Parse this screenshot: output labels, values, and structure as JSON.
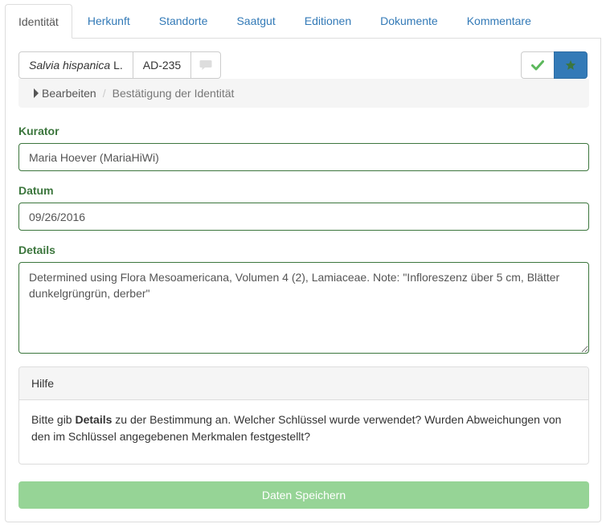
{
  "tabs": [
    {
      "label": "Identität",
      "active": true
    },
    {
      "label": "Herkunft",
      "active": false
    },
    {
      "label": "Standorte",
      "active": false
    },
    {
      "label": "Saatgut",
      "active": false
    },
    {
      "label": "Editionen",
      "active": false
    },
    {
      "label": "Dokumente",
      "active": false
    },
    {
      "label": "Kommentare",
      "active": false
    }
  ],
  "identity": {
    "species": "Salvia hispanica",
    "author": "L.",
    "accession": "AD-235"
  },
  "breadcrumb": {
    "edit": "Bearbeiten",
    "current": "Bestätigung der Identität"
  },
  "form": {
    "curator_label": "Kurator",
    "curator_value": "Maria Hoever (MariaHiWi)",
    "date_label": "Datum",
    "date_value": "09/26/2016",
    "details_label": "Details",
    "details_value": "Determined using Flora Mesoamericana, Volumen 4 (2), Lamiaceae. Note: \"Infloreszenz über 5 cm, Blätter dunkelgrüngrün, derber\""
  },
  "help": {
    "title": "Hilfe",
    "text_before": "Bitte gib ",
    "text_bold": "Details",
    "text_after": " zu der Bestimmung an. Welcher Schlüssel wurde verwendet? Wurden Abweichungen von den im Schlüssel angegebenen Merkmalen festgestellt?"
  },
  "save_label": "Daten Speichern",
  "colors": {
    "link": "#337ab7",
    "success": "#3c763d",
    "check": "#5cb85c",
    "primary": "#337ab7",
    "save_disabled": "#96d496"
  },
  "icons": {
    "comment": "comment-icon",
    "check": "check-icon",
    "star": "star-icon",
    "caret": "caret-right-icon"
  }
}
